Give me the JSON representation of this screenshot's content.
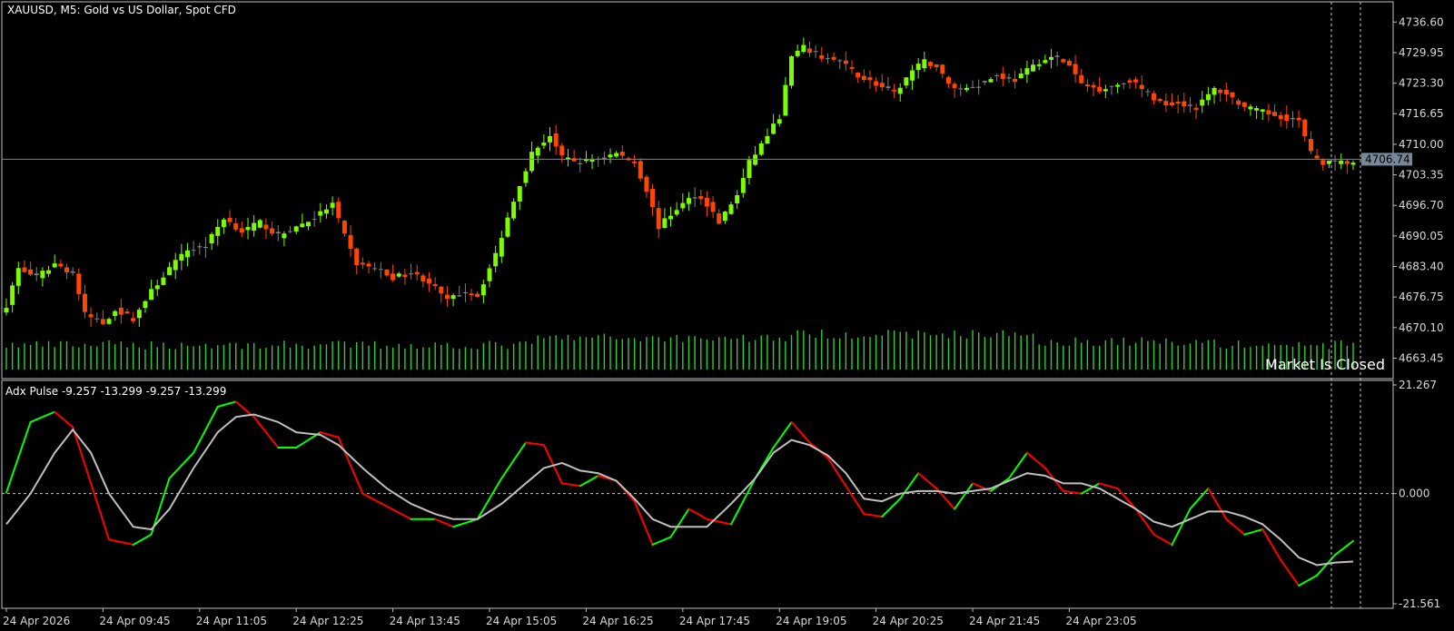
{
  "header": {
    "symbol_title": "XAUUSD, M5:  Gold vs US Dollar, Spot CFD"
  },
  "market_status": "Market Is Closed",
  "indicator": {
    "label": "Adx Pulse -9.257 -13.299 -9.257 -13.299"
  },
  "colors": {
    "background": "#000000",
    "bull": "#7CFC00",
    "bear": "#FF4500",
    "doji": "#808080",
    "volume": "#32CD32",
    "adx_up": "#00FF00",
    "adx_down": "#FF0000",
    "signal": "#C0C0C0",
    "price_line": "#778899",
    "axis_text": "#d8d8d8"
  },
  "chart_data": [
    {
      "type": "candlestick",
      "title": "XAUUSD, M5:  Gold vs US Dollar, Spot CFD",
      "ylim": [
        4659.0,
        4741.0
      ],
      "y_ticks": [
        "4736.60",
        "4729.95",
        "4723.30",
        "4716.65",
        "4710.00",
        "4703.35",
        "4696.70",
        "4690.05",
        "4683.40",
        "4676.75",
        "4670.10",
        "4663.45"
      ],
      "current_price": "4706.74",
      "x_ticks": [
        "24 Apr 2026",
        "24 Apr 09:45",
        "24 Apr 11:05",
        "24 Apr 12:25",
        "24 Apr 13:45",
        "24 Apr 15:05",
        "24 Apr 16:25",
        "24 Apr 17:45",
        "24 Apr 19:05",
        "24 Apr 20:25",
        "24 Apr 21:45",
        "24 Apr 23:05"
      ],
      "close_anchors": [
        [
          0,
          4675
        ],
        [
          2,
          4683
        ],
        [
          5,
          4681
        ],
        [
          8,
          4684
        ],
        [
          11,
          4682
        ],
        [
          13,
          4673
        ],
        [
          16,
          4671
        ],
        [
          18,
          4674
        ],
        [
          21,
          4672
        ],
        [
          24,
          4678
        ],
        [
          27,
          4683
        ],
        [
          30,
          4687
        ],
        [
          33,
          4688
        ],
        [
          36,
          4694
        ],
        [
          39,
          4691
        ],
        [
          42,
          4693
        ],
        [
          45,
          4690
        ],
        [
          48,
          4692
        ],
        [
          51,
          4694
        ],
        [
          54,
          4697
        ],
        [
          56,
          4690
        ],
        [
          58,
          4684
        ],
        [
          61,
          4683
        ],
        [
          64,
          4681
        ],
        [
          67,
          4682
        ],
        [
          70,
          4680
        ],
        [
          73,
          4676
        ],
        [
          76,
          4678
        ],
        [
          78,
          4677
        ],
        [
          81,
          4686
        ],
        [
          84,
          4698
        ],
        [
          87,
          4708
        ],
        [
          90,
          4712
        ],
        [
          92,
          4707
        ],
        [
          95,
          4706
        ],
        [
          98,
          4707
        ],
        [
          101,
          4708
        ],
        [
          104,
          4706
        ],
        [
          106,
          4700
        ],
        [
          108,
          4692
        ],
        [
          111,
          4696
        ],
        [
          114,
          4699
        ],
        [
          116,
          4697
        ],
        [
          118,
          4693
        ],
        [
          121,
          4699
        ],
        [
          123,
          4706
        ],
        [
          126,
          4712
        ],
        [
          128,
          4716
        ],
        [
          130,
          4729
        ],
        [
          132,
          4731
        ],
        [
          135,
          4729
        ],
        [
          138,
          4728
        ],
        [
          141,
          4725
        ],
        [
          144,
          4723
        ],
        [
          147,
          4721
        ],
        [
          150,
          4726
        ],
        [
          152,
          4728
        ],
        [
          154,
          4727
        ],
        [
          156,
          4723
        ],
        [
          158,
          4722
        ],
        [
          161,
          4723
        ],
        [
          164,
          4725
        ],
        [
          167,
          4724
        ],
        [
          169,
          4726
        ],
        [
          171,
          4728
        ],
        [
          174,
          4729
        ],
        [
          176,
          4727
        ],
        [
          178,
          4723
        ],
        [
          181,
          4722
        ],
        [
          184,
          4723
        ],
        [
          186,
          4724
        ],
        [
          188,
          4722
        ],
        [
          191,
          4719
        ],
        [
          194,
          4719
        ],
        [
          197,
          4718
        ],
        [
          200,
          4722
        ],
        [
          202,
          4721
        ],
        [
          205,
          4718
        ],
        [
          208,
          4717
        ],
        [
          211,
          4716
        ],
        [
          214,
          4715
        ],
        [
          216,
          4708
        ],
        [
          218,
          4706
        ],
        [
          221,
          4706
        ],
        [
          223,
          4706
        ]
      ],
      "n_bars": 224
    },
    {
      "type": "line",
      "title": "Adx Pulse -9.257 -13.299 -9.257 -13.299",
      "ylim": [
        -21.561,
        21.267
      ],
      "y_ticks": [
        "21.267",
        "0.000",
        "-21.561"
      ],
      "series": [
        {
          "values_anchors": [
            [
              0,
              0.2
            ],
            [
              4,
              14.0
            ],
            [
              8,
              16.0
            ],
            [
              11,
              13.0
            ],
            [
              14,
              2.0
            ],
            [
              17,
              -9.0
            ],
            [
              21,
              -10.0
            ],
            [
              24,
              -8.0
            ],
            [
              27,
              3.0
            ],
            [
              31,
              8.0
            ],
            [
              35,
              17.0
            ],
            [
              38,
              18.0
            ],
            [
              41,
              15.0
            ],
            [
              45,
              9.0
            ],
            [
              48,
              9.0
            ],
            [
              52,
              12.0
            ],
            [
              55,
              11.0
            ],
            [
              59,
              0.0
            ],
            [
              63,
              -2.5
            ],
            [
              67,
              -5.0
            ],
            [
              71,
              -5.0
            ],
            [
              74,
              -6.5
            ],
            [
              78,
              -5.0
            ],
            [
              82,
              3.0
            ],
            [
              86,
              10.0
            ],
            [
              89,
              9.5
            ],
            [
              92,
              2.0
            ],
            [
              95,
              1.5
            ],
            [
              98,
              3.5
            ],
            [
              101,
              2.5
            ],
            [
              104,
              -1.5
            ],
            [
              107,
              -10.0
            ],
            [
              110,
              -8.5
            ],
            [
              113,
              -3.0
            ],
            [
              116,
              -5.0
            ],
            [
              120,
              -6.0
            ],
            [
              124,
              3.0
            ],
            [
              127,
              9.0
            ],
            [
              130,
              14.0
            ],
            [
              133,
              10.0
            ],
            [
              136,
              7.0
            ],
            [
              139,
              1.5
            ],
            [
              142,
              -4.0
            ],
            [
              145,
              -4.5
            ],
            [
              148,
              -1.0
            ],
            [
              151,
              4.0
            ],
            [
              154,
              1.0
            ],
            [
              157,
              -3.0
            ],
            [
              160,
              2.0
            ],
            [
              163,
              0.5
            ],
            [
              166,
              3.0
            ],
            [
              169,
              8.0
            ],
            [
              172,
              5.0
            ],
            [
              175,
              0.5
            ],
            [
              178,
              0.0
            ],
            [
              181,
              2.0
            ],
            [
              184,
              1.0
            ],
            [
              187,
              -3.0
            ],
            [
              190,
              -8.0
            ],
            [
              193,
              -10.0
            ],
            [
              196,
              -3.0
            ],
            [
              199,
              1.0
            ],
            [
              202,
              -5.0
            ],
            [
              205,
              -8.0
            ],
            [
              208,
              -7.0
            ],
            [
              211,
              -13.0
            ],
            [
              214,
              -18.0
            ],
            [
              217,
              -16.0
            ],
            [
              220,
              -12.0
            ],
            [
              223,
              -9.257
            ]
          ]
        },
        {
          "values_anchors": [
            [
              0,
              -6.0
            ],
            [
              4,
              0.0
            ],
            [
              8,
              8.0
            ],
            [
              11,
              12.5
            ],
            [
              14,
              8.0
            ],
            [
              17,
              0.0
            ],
            [
              21,
              -6.5
            ],
            [
              24,
              -7.0
            ],
            [
              27,
              -3.0
            ],
            [
              31,
              5.0
            ],
            [
              35,
              12.0
            ],
            [
              38,
              15.0
            ],
            [
              41,
              15.5
            ],
            [
              45,
              14.0
            ],
            [
              48,
              12.0
            ],
            [
              52,
              11.5
            ],
            [
              55,
              9.5
            ],
            [
              59,
              5.0
            ],
            [
              63,
              1.0
            ],
            [
              67,
              -2.0
            ],
            [
              71,
              -4.0
            ],
            [
              74,
              -5.0
            ],
            [
              78,
              -5.0
            ],
            [
              82,
              -2.0
            ],
            [
              86,
              2.0
            ],
            [
              89,
              5.0
            ],
            [
              92,
              6.0
            ],
            [
              95,
              4.5
            ],
            [
              98,
              4.0
            ],
            [
              101,
              2.5
            ],
            [
              104,
              -1.0
            ],
            [
              107,
              -5.0
            ],
            [
              110,
              -6.5
            ],
            [
              113,
              -6.5
            ],
            [
              116,
              -6.5
            ],
            [
              120,
              -2.0
            ],
            [
              124,
              3.0
            ],
            [
              127,
              8.0
            ],
            [
              130,
              10.5
            ],
            [
              133,
              9.5
            ],
            [
              136,
              7.5
            ],
            [
              139,
              4.0
            ],
            [
              142,
              -1.0
            ],
            [
              145,
              -1.5
            ],
            [
              148,
              0.0
            ],
            [
              151,
              0.5
            ],
            [
              154,
              0.5
            ],
            [
              157,
              0.0
            ],
            [
              160,
              0.5
            ],
            [
              163,
              1.0
            ],
            [
              166,
              2.5
            ],
            [
              169,
              4.0
            ],
            [
              172,
              3.5
            ],
            [
              175,
              2.0
            ],
            [
              178,
              2.0
            ],
            [
              181,
              1.0
            ],
            [
              184,
              -1.0
            ],
            [
              187,
              -3.0
            ],
            [
              190,
              -5.5
            ],
            [
              193,
              -6.5
            ],
            [
              196,
              -5.0
            ],
            [
              199,
              -3.5
            ],
            [
              202,
              -3.5
            ],
            [
              205,
              -4.5
            ],
            [
              208,
              -6.0
            ],
            [
              211,
              -9.0
            ],
            [
              214,
              -12.5
            ],
            [
              217,
              -14.0
            ],
            [
              220,
              -13.5
            ],
            [
              223,
              -13.299
            ]
          ]
        }
      ]
    }
  ]
}
